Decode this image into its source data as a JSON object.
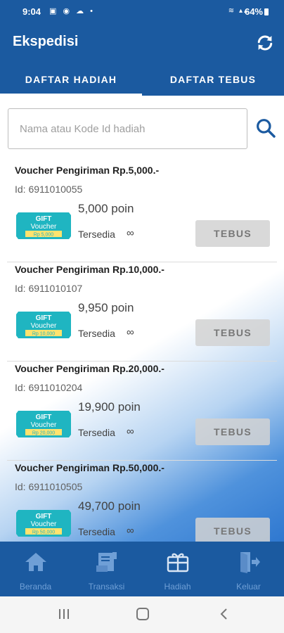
{
  "status_bar": {
    "time": "9:04",
    "battery": "64%"
  },
  "app": {
    "title": "Ekspedisi"
  },
  "tabs": [
    {
      "label": "DAFTAR HADIAH",
      "active": true
    },
    {
      "label": "DAFTAR TEBUS",
      "active": false
    }
  ],
  "search": {
    "placeholder": "Nama atau Kode Id hadiah"
  },
  "items": [
    {
      "title": "Voucher Pengiriman Rp.5,000.-",
      "id": "Id: 6911010055",
      "points": "5,000 poin",
      "availability": "Tersedia",
      "stock": "∞",
      "button": "TEBUS",
      "voucher_gift": "GIFT",
      "voucher_word": "Voucher",
      "voucher_amount": "Rp 5,000"
    },
    {
      "title": "Voucher Pengiriman Rp.10,000.-",
      "id": "Id: 6911010107",
      "points": "9,950 poin",
      "availability": "Tersedia",
      "stock": "∞",
      "button": "TEBUS",
      "voucher_gift": "GIFT",
      "voucher_word": "Voucher",
      "voucher_amount": "Rp 10,000"
    },
    {
      "title": "Voucher Pengiriman Rp.20,000.-",
      "id": "Id: 6911010204",
      "points": "19,900 poin",
      "availability": "Tersedia",
      "stock": "∞",
      "button": "TEBUS",
      "voucher_gift": "GIFT",
      "voucher_word": "Voucher",
      "voucher_amount": "Rp 20,000"
    },
    {
      "title": "Voucher Pengiriman Rp.50,000.-",
      "id": "Id: 6911010505",
      "points": "49,700 poin",
      "availability": "Tersedia",
      "stock": "∞",
      "button": "TEBUS",
      "voucher_gift": "GIFT",
      "voucher_word": "Voucher",
      "voucher_amount": "Rp 50,000"
    }
  ],
  "bottom_nav": [
    {
      "label": "Beranda",
      "icon": "home-icon"
    },
    {
      "label": "Transaksi",
      "icon": "receipt-icon"
    },
    {
      "label": "Hadiah",
      "icon": "gift-icon"
    },
    {
      "label": "Keluar",
      "icon": "logout-icon"
    }
  ],
  "colors": {
    "primary": "#1b5aa0",
    "voucher": "#1fb5c1",
    "nav_label": "#6f9fd6"
  }
}
